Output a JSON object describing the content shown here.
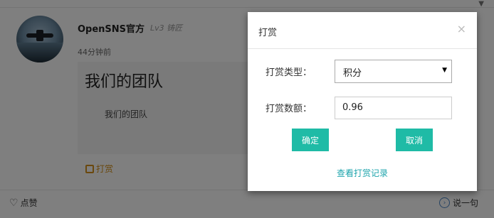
{
  "feed": {
    "username": "OpenSNS官方",
    "level": "Lv3 铸匠",
    "time_ago": "44分钟前",
    "post_title": "我们的团队",
    "post_body": "我们的团队",
    "reward_label": "打赏",
    "like_label": "点赞",
    "comment_label": "说一句"
  },
  "modal": {
    "title": "打赏",
    "close_symbol": "×",
    "type_label": "打赏类型：",
    "type_value": "积分",
    "amount_label": "打赏数额：",
    "amount_value": "0.96",
    "confirm_label": "确定",
    "cancel_label": "取消",
    "history_link": "查看打赏记录"
  },
  "colors": {
    "accent": "#1fbba6",
    "link": "#1fa5ad",
    "reward": "#d4901a",
    "overlay": "rgba(0,0,0,0.5)"
  },
  "icons": {
    "reward": "coin-stack-icon",
    "like": "heart-icon",
    "comment": "comment-icon",
    "dropdown": "triangle-down-icon",
    "close": "close-icon"
  }
}
